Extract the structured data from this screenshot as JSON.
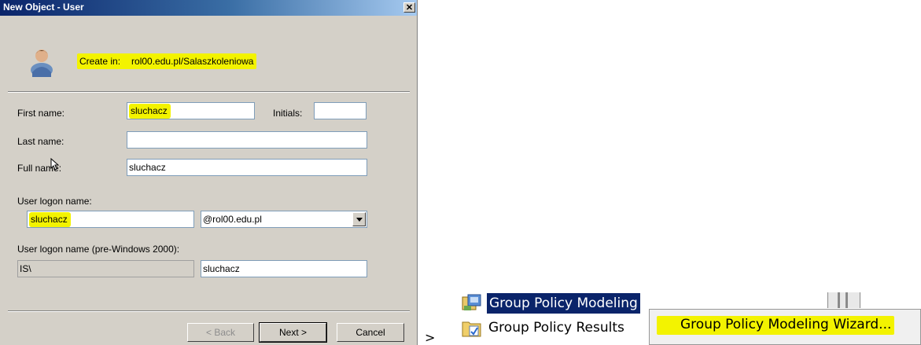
{
  "dialog": {
    "title": "New Object - User",
    "close_glyph": "✕",
    "create_in_label": "Create in:",
    "create_in_path": "rol00.edu.pl/Salaszkoleniowa",
    "first_name_label": "First name:",
    "first_name_value": "sluchacz",
    "initials_label": "Initials:",
    "initials_value": "",
    "last_name_label": "Last name:",
    "last_name_value": "",
    "full_name_label": "Full name:",
    "full_name_value": "sluchacz",
    "logon_label": "User logon name:",
    "logon_value": "sluchacz",
    "domain_value": "@rol00.edu.pl",
    "pre2000_label": "User logon name (pre-Windows 2000):",
    "pre2000_domain": "IS\\",
    "pre2000_value": "sluchacz",
    "back_label": "< Back",
    "next_label": "Next >",
    "cancel_label": "Cancel",
    "highlight_color": "#f3f300",
    "icons": [
      "user-icon",
      "close-icon",
      "chevron-down-icon"
    ]
  },
  "gpmc": {
    "modeling_label": "Group Policy Modeling",
    "results_label": "Group Policy Results",
    "context_menu_item": "Group Policy Modeling Wizard...",
    "selection_color": "#0a246a",
    "icons": [
      "modeling-icon",
      "results-icon"
    ]
  },
  "connector_glyph": ">"
}
